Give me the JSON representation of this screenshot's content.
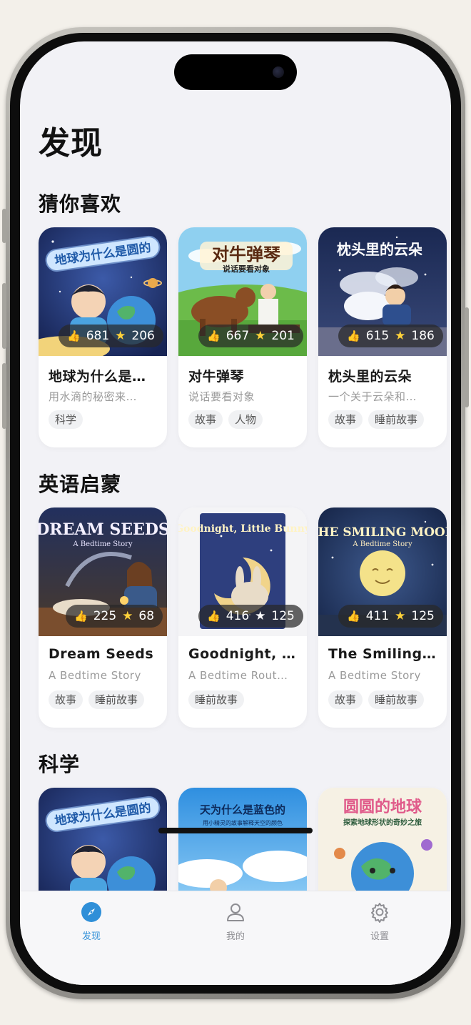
{
  "page": {
    "title": "发现"
  },
  "sections": [
    {
      "title": "猜你喜欢",
      "cards": [
        {
          "title": "地球为什么是…",
          "subtitle": "用水滴的秘密来…",
          "likes": "681",
          "stars": "206",
          "tags": [
            "科学"
          ]
        },
        {
          "title": "对牛弹琴",
          "subtitle": "说话要看对象",
          "likes": "667",
          "stars": "201",
          "tags": [
            "故事",
            "人物"
          ]
        },
        {
          "title": "枕头里的云朵",
          "subtitle": "一个关于云朵和…",
          "likes": "615",
          "stars": "186",
          "tags": [
            "故事",
            "睡前故事"
          ]
        }
      ]
    },
    {
      "title": "英语启蒙",
      "cards": [
        {
          "title": "Dream Seeds",
          "subtitle": "A Bedtime Story",
          "likes": "225",
          "stars": "68",
          "tags": [
            "故事",
            "睡前故事"
          ]
        },
        {
          "title": "Goodnight, …",
          "subtitle": "A Bedtime Rout…",
          "likes": "416",
          "stars": "125",
          "tags": [
            "睡前故事"
          ]
        },
        {
          "title": "The Smiling …",
          "subtitle": "A Bedtime Story",
          "likes": "411",
          "stars": "125",
          "tags": [
            "故事",
            "睡前故事"
          ]
        }
      ]
    },
    {
      "title": "科学",
      "cards": [
        {
          "title": "",
          "subtitle": "",
          "likes": "",
          "stars": "",
          "tags": []
        },
        {
          "title": "",
          "subtitle": "",
          "likes": "",
          "stars": "",
          "tags": []
        },
        {
          "title": "",
          "subtitle": "",
          "likes": "",
          "stars": "",
          "tags": []
        }
      ]
    }
  ],
  "covers": [
    {
      "headline": "地球为什么是圆的",
      "sub": ""
    },
    {
      "headline": "对牛弹琴",
      "sub": "说话要看对象"
    },
    {
      "headline": "枕头里的云朵",
      "sub": ""
    },
    {
      "headline": "DREAM SEEDS",
      "sub": "A Bedtime Story"
    },
    {
      "headline": "Goodnight, Little Bunny",
      "sub": ""
    },
    {
      "headline": "THE SMILING MOON",
      "sub": "A Bedtime Story"
    },
    {
      "headline": "地球为什么是圆的",
      "sub": ""
    },
    {
      "headline": "天为什么是蓝色的",
      "sub": "用小精灵的故事解释天空的颜色"
    },
    {
      "headline": "圆圆的地球",
      "sub": "探索地球形状的奇妙之旅"
    }
  ],
  "tabbar": {
    "tabs": [
      {
        "label": "发现",
        "icon": "compass-icon",
        "active": true
      },
      {
        "label": "我的",
        "icon": "person-icon",
        "active": false
      },
      {
        "label": "设置",
        "icon": "gear-icon",
        "active": false
      }
    ]
  },
  "colors": {
    "accent": "#2f8fd8",
    "star": "#ffd23a",
    "background": "#f2f2f6"
  }
}
